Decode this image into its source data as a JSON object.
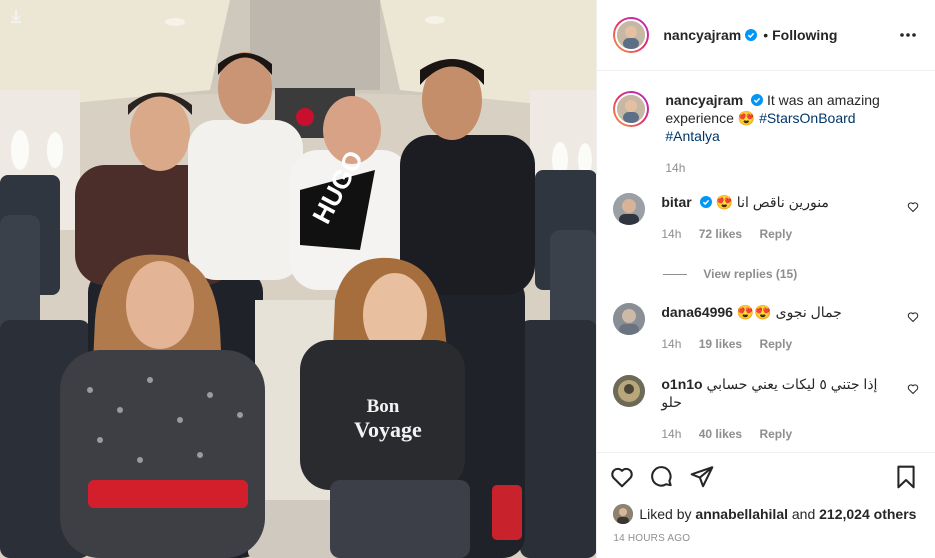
{
  "post": {
    "username": "nancyajram",
    "separator": "•",
    "follow_state": "Following"
  },
  "caption": {
    "username": "nancyajram",
    "text": "It was an amazing experience 😍",
    "hashtags": [
      "#StarsOnBoard",
      "#Antalya"
    ],
    "age": "14h"
  },
  "comments": [
    {
      "username": "bitar",
      "verified": true,
      "text": "منورين ناقص انا 😍",
      "age": "14h",
      "likes": "72 likes",
      "reply": "Reply",
      "view_replies": "View replies (15)"
    },
    {
      "username": "dana64996",
      "verified": false,
      "text": "جمال نجوى 😍😍",
      "age": "14h",
      "likes": "19 likes",
      "reply": "Reply"
    },
    {
      "username": "o1n1o",
      "verified": false,
      "text": "إذا جتني ٥ ليكات يعني حسابي حلو",
      "age": "14h",
      "likes": "40 likes",
      "reply": "Reply"
    }
  ],
  "likes": {
    "prefix": "Liked by",
    "liker": "annabellahilal",
    "conjunction": "and",
    "others": "212,024 others"
  },
  "timestamp": "14 HOURS AGO",
  "photo_text": {
    "shirt_line1": "Bon",
    "shirt_line2": "Voyage",
    "hugo_shirt": "HUGO"
  },
  "icons": [
    "more-options-icon",
    "verified-icon",
    "like-icon",
    "comment-icon",
    "share-icon",
    "save-icon",
    "small-heart-icon",
    "photo-corner-icon"
  ],
  "colors": {
    "verified": "#0095f6",
    "link": "#00376b",
    "muted": "#8e8e8e",
    "ring_start": "#f9a13a",
    "ring_end": "#b12ad0"
  }
}
